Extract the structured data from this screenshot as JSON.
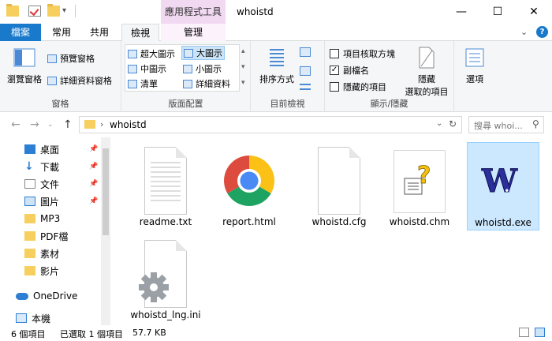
{
  "window": {
    "title": "whoistd",
    "context_tab_group": "應用程式工具",
    "minimize": "—",
    "maximize": "☐",
    "close": "✕"
  },
  "tabs": {
    "file": "檔案",
    "home": "常用",
    "share": "共用",
    "view": "檢視",
    "manage": "管理"
  },
  "ribbon": {
    "pane": {
      "navigation_pane": "瀏覽窗格",
      "preview_pane": "預覽窗格",
      "details_pane": "詳細資料窗格",
      "label": "窗格"
    },
    "layout": {
      "extra_large": "超大圖示",
      "large": "大圖示",
      "medium": "中圖示",
      "small": "小圖示",
      "list": "清單",
      "details": "詳細資料",
      "label": "版面配置"
    },
    "current_view": {
      "sort_by": "排序方式",
      "label": "目前檢視"
    },
    "show_hide": {
      "item_checkboxes": "項目核取方塊",
      "file_extensions": "副檔名",
      "hidden_items": "隱藏的項目",
      "hide_selected_1": "隱藏",
      "hide_selected_2": "選取的項目",
      "label": "顯示/隱藏"
    },
    "options": {
      "label": "選項"
    }
  },
  "address": {
    "path": "whoistd",
    "search_placeholder": "搜尋 whoi..."
  },
  "nav": {
    "items": [
      {
        "label": "桌面",
        "pinned": true
      },
      {
        "label": "下載",
        "pinned": true
      },
      {
        "label": "文件",
        "pinned": true
      },
      {
        "label": "圖片",
        "pinned": true
      },
      {
        "label": "MP3",
        "pinned": false
      },
      {
        "label": "PDF檔",
        "pinned": false
      },
      {
        "label": "素材",
        "pinned": false
      },
      {
        "label": "影片",
        "pinned": false
      },
      {
        "label": "OneDrive",
        "pinned": false
      },
      {
        "label": "本機",
        "pinned": false
      }
    ]
  },
  "files": [
    {
      "name": "readme.txt",
      "type": "text"
    },
    {
      "name": "report.html",
      "type": "chrome"
    },
    {
      "name": "whoistd.cfg",
      "type": "blank"
    },
    {
      "name": "whoistd.chm",
      "type": "help"
    },
    {
      "name": "whoistd.exe",
      "type": "exe",
      "selected": true
    },
    {
      "name": "whoistd_lng.ini",
      "type": "settings"
    }
  ],
  "status": {
    "count": "6 個項目",
    "selected": "已選取 1 個項目",
    "size": "57.7 KB"
  },
  "colors": {
    "accent": "#1979ca",
    "selection": "#cce8ff",
    "context_tab": "#f1d9f1"
  }
}
